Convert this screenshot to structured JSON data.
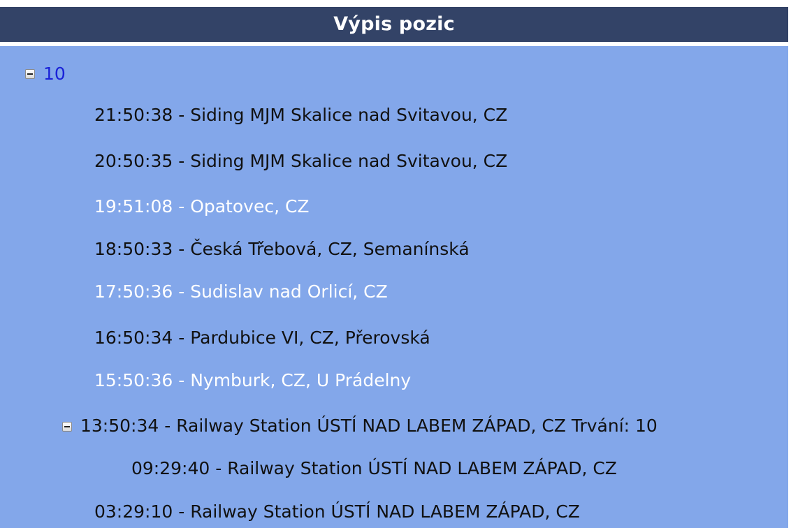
{
  "panel": {
    "title": "Výpis pozic"
  },
  "tree": {
    "root": {
      "label": "10",
      "items": [
        {
          "text": "21:50:38 - Siding MJM Skalice nad Svitavou, CZ",
          "color": "#111111"
        },
        {
          "text": "20:50:35 - Siding MJM Skalice nad Svitavou, CZ",
          "color": "#111111"
        },
        {
          "text": "19:51:08 - Opatovec, CZ",
          "color": "#ffffff"
        },
        {
          "text": "18:50:33 - Česká Třebová, CZ, Semanínská",
          "color": "#111111"
        },
        {
          "text": "17:50:36 - Sudislav nad Orlicí, CZ",
          "color": "#ffffff"
        },
        {
          "text": "16:50:34 - Pardubice VI, CZ, Přerovská",
          "color": "#111111"
        },
        {
          "text": "15:50:36 - Nymburk, CZ, U Prádelny",
          "color": "#ffffff"
        },
        {
          "text": "13:50:34 - Railway Station ÚSTÍ NAD LABEM ZÁPAD, CZ Trvání: 10",
          "color": "#111111",
          "expanded": true
        },
        {
          "text": "09:29:40 - Railway Station ÚSTÍ NAD LABEM ZÁPAD, CZ",
          "color": "#111111"
        },
        {
          "text": "03:29:10 - Railway Station ÚSTÍ NAD LABEM ZÁPAD, CZ",
          "color": "#111111"
        }
      ]
    }
  },
  "icons": {
    "collapse": "minus-box-icon"
  },
  "colors": {
    "header_bg": "#334367",
    "tree_bg": "#83a7ea",
    "root_label": "#1a22d8"
  }
}
